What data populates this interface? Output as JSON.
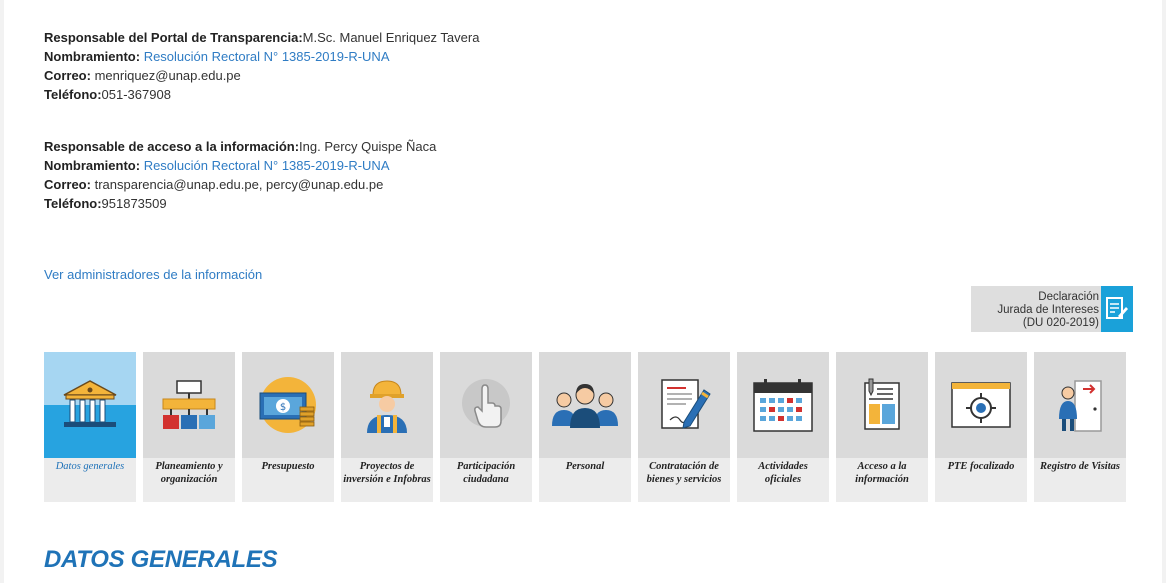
{
  "responsable_portal": {
    "label": "Responsable del Portal de Transparencia:",
    "value": "M.Sc. Manuel Enriquez Tavera",
    "nombramiento_label": "Nombramiento:",
    "nombramiento_link": "Resolución Rectoral N° 1385-2019-R-UNA",
    "correo_label": "Correo:",
    "correo_value": "menriquez@unap.edu.pe",
    "telefono_label": "Teléfono:",
    "telefono_value": "051-367908"
  },
  "responsable_acceso": {
    "label": "Responsable de acceso a la información:",
    "value": "Ing. Percy Quispe Ñaca",
    "nombramiento_label": "Nombramiento:",
    "nombramiento_link": "Resolución Rectoral N° 1385-2019-R-UNA",
    "correo_label": "Correo:",
    "correo_value": "transparencia@unap.edu.pe, percy@unap.edu.pe",
    "telefono_label": "Teléfono:",
    "telefono_value": "951873509"
  },
  "ver_administradores": "Ver administradores de la información",
  "declaracion": {
    "line1": "Declaración",
    "line2": "Jurada de Intereses",
    "line3": "(DU 020-2019)",
    "icon": "document-pen-icon"
  },
  "tiles": [
    {
      "label": "Datos generales",
      "icon": "institution-building-icon",
      "active": true
    },
    {
      "label": "Planeamiento y organización",
      "icon": "org-chart-icon"
    },
    {
      "label": "Presupuesto",
      "icon": "money-coins-icon"
    },
    {
      "label": "Proyectos de inversión e Infobras",
      "icon": "worker-helmet-icon"
    },
    {
      "label": "Participación ciudadana",
      "icon": "hand-pointer-icon"
    },
    {
      "label": "Personal",
      "icon": "people-group-icon"
    },
    {
      "label": "Contratación de bienes y servicios",
      "icon": "contract-pen-icon"
    },
    {
      "label": "Actividades oficiales",
      "icon": "calendar-icon"
    },
    {
      "label": "Acceso a la información",
      "icon": "clipboard-document-icon"
    },
    {
      "label": "PTE focalizado",
      "icon": "target-screen-icon"
    },
    {
      "label": "Registro de Visitas",
      "icon": "visitor-door-icon"
    }
  ],
  "section_title": "DATOS GENERALES",
  "colors": {
    "link": "#2f7cc4",
    "accent": "#1aa1d9",
    "title": "#1f73b7"
  }
}
